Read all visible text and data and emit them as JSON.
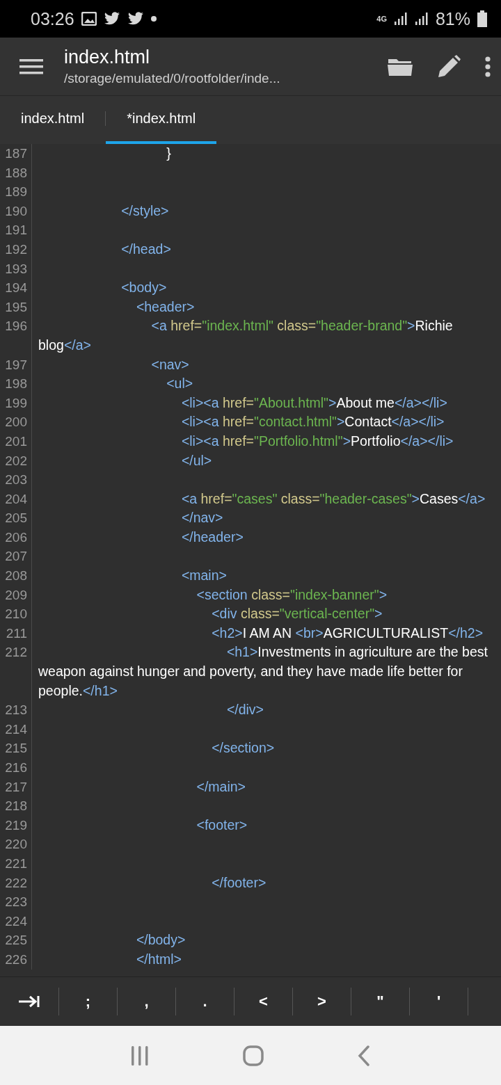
{
  "status_bar": {
    "time": "03:26",
    "network": "4G",
    "battery": "81%"
  },
  "app_bar": {
    "title": "index.html",
    "subtitle": "/storage/emulated/0/rootfolder/inde..."
  },
  "tabs": [
    {
      "label": "index.html",
      "selected": false
    },
    {
      "label": "*index.html",
      "selected": true
    }
  ],
  "editor": {
    "lines": [
      {
        "number": "187",
        "tokens": [
          {
            "kind": "text",
            "text": "                                  }"
          }
        ]
      },
      {
        "number": "188"
      },
      {
        "number": "189"
      },
      {
        "number": "190",
        "tokens": [
          {
            "kind": "tag",
            "text": "                      </style>"
          }
        ]
      },
      {
        "number": "191"
      },
      {
        "number": "192",
        "tokens": [
          {
            "kind": "tag",
            "text": "                      </head>"
          }
        ]
      },
      {
        "number": "193"
      },
      {
        "number": "194",
        "tokens": [
          {
            "kind": "tag",
            "text": "                      <body>"
          }
        ]
      },
      {
        "number": "195",
        "tokens": [
          {
            "kind": "tag",
            "text": "                          <header>"
          }
        ]
      },
      {
        "number": "196",
        "tokens": [
          {
            "kind": "tag",
            "text": "                              <a"
          },
          {
            "kind": "attr",
            "text": " href="
          },
          {
            "kind": "string",
            "text": "\"index.html\""
          },
          {
            "kind": "attr",
            "text": " class="
          },
          {
            "kind": "string",
            "text": "\"header-brand\""
          },
          {
            "kind": "tag",
            "text": ">"
          },
          {
            "kind": "text",
            "text": "Richie blog"
          },
          {
            "kind": "tag",
            "text": "</a>"
          }
        ]
      },
      {
        "number": "197",
        "tokens": [
          {
            "kind": "tag",
            "text": "                              <nav>"
          }
        ]
      },
      {
        "number": "198",
        "tokens": [
          {
            "kind": "tag",
            "text": "                                  <ul>"
          }
        ]
      },
      {
        "number": "199",
        "tokens": [
          {
            "kind": "tag",
            "text": "                                      <li><a"
          },
          {
            "kind": "attr",
            "text": " href="
          },
          {
            "kind": "string",
            "text": "\"About.html\""
          },
          {
            "kind": "tag",
            "text": ">"
          },
          {
            "kind": "text",
            "text": "About me"
          },
          {
            "kind": "tag",
            "text": "</a></li>"
          }
        ]
      },
      {
        "number": "200",
        "tokens": [
          {
            "kind": "tag",
            "text": "                                      <li><a"
          },
          {
            "kind": "attr",
            "text": " href="
          },
          {
            "kind": "string",
            "text": "\"contact.html\""
          },
          {
            "kind": "tag",
            "text": ">"
          },
          {
            "kind": "text",
            "text": "Contact"
          },
          {
            "kind": "tag",
            "text": "</a></li>"
          }
        ]
      },
      {
        "number": "201",
        "tokens": [
          {
            "kind": "tag",
            "text": "                                      <li><a"
          },
          {
            "kind": "attr",
            "text": " href="
          },
          {
            "kind": "string",
            "text": "\"Portfolio.html\""
          },
          {
            "kind": "tag",
            "text": ">"
          },
          {
            "kind": "text",
            "text": "Portfolio"
          },
          {
            "kind": "tag",
            "text": "</a></li>"
          }
        ]
      },
      {
        "number": "202",
        "tokens": [
          {
            "kind": "tag",
            "text": "                                      </ul>"
          }
        ]
      },
      {
        "number": "203"
      },
      {
        "number": "204",
        "tokens": [
          {
            "kind": "tag",
            "text": "                                      <a"
          },
          {
            "kind": "attr",
            "text": " href="
          },
          {
            "kind": "string",
            "text": "\"cases\""
          },
          {
            "kind": "attr",
            "text": " class="
          },
          {
            "kind": "string",
            "text": "\"header-cases\""
          },
          {
            "kind": "tag",
            "text": ">"
          },
          {
            "kind": "text",
            "text": "Cases"
          },
          {
            "kind": "tag",
            "text": "</a>"
          }
        ]
      },
      {
        "number": "205",
        "tokens": [
          {
            "kind": "tag",
            "text": "                                      </nav>"
          }
        ]
      },
      {
        "number": "206",
        "tokens": [
          {
            "kind": "tag",
            "text": "                                      </header>"
          }
        ]
      },
      {
        "number": "207"
      },
      {
        "number": "208",
        "tokens": [
          {
            "kind": "tag",
            "text": "                                      <main>"
          }
        ]
      },
      {
        "number": "209",
        "tokens": [
          {
            "kind": "tag",
            "text": "                                          <section"
          },
          {
            "kind": "attr",
            "text": " class="
          },
          {
            "kind": "string",
            "text": "\"index-banner\""
          },
          {
            "kind": "tag",
            "text": ">"
          }
        ]
      },
      {
        "number": "210",
        "tokens": [
          {
            "kind": "tag",
            "text": "                                              <div"
          },
          {
            "kind": "attr",
            "text": " class="
          },
          {
            "kind": "string",
            "text": "\"vertical-center\""
          },
          {
            "kind": "tag",
            "text": ">"
          }
        ]
      },
      {
        "number": "211",
        "tokens": [
          {
            "kind": "tag",
            "text": "                                              <h2>"
          },
          {
            "kind": "text",
            "text": "I AM AN "
          },
          {
            "kind": "tag",
            "text": "<br>"
          },
          {
            "kind": "text",
            "text": "AGRICULTURALIST"
          },
          {
            "kind": "tag",
            "text": "</h2>"
          }
        ]
      },
      {
        "number": "212",
        "tokens": [
          {
            "kind": "tag",
            "text": "                                                  <h1>"
          },
          {
            "kind": "text",
            "text": "Investments in agriculture are the best weapon against hunger and poverty, and they have made life better for people."
          },
          {
            "kind": "tag",
            "text": "</h1>"
          }
        ]
      },
      {
        "number": "213",
        "tokens": [
          {
            "kind": "tag",
            "text": "                                                  </div>"
          }
        ]
      },
      {
        "number": "214"
      },
      {
        "number": "215",
        "tokens": [
          {
            "kind": "tag",
            "text": "                                              </section>"
          }
        ]
      },
      {
        "number": "216"
      },
      {
        "number": "217",
        "tokens": [
          {
            "kind": "tag",
            "text": "                                          </main>"
          }
        ]
      },
      {
        "number": "218"
      },
      {
        "number": "219",
        "tokens": [
          {
            "kind": "tag",
            "text": "                                          <footer>"
          }
        ]
      },
      {
        "number": "220"
      },
      {
        "number": "221"
      },
      {
        "number": "222",
        "tokens": [
          {
            "kind": "tag",
            "text": "                                              </footer>"
          }
        ]
      },
      {
        "number": "223"
      },
      {
        "number": "224"
      },
      {
        "number": "225",
        "tokens": [
          {
            "kind": "tag",
            "text": "                          </body>"
          }
        ]
      },
      {
        "number": "226",
        "tokens": [
          {
            "kind": "tag",
            "text": "                          </html>"
          }
        ]
      }
    ]
  },
  "symbol_bar": {
    "keys": [
      ";",
      ",",
      ".",
      "<",
      ">",
      "\"",
      "'"
    ]
  }
}
